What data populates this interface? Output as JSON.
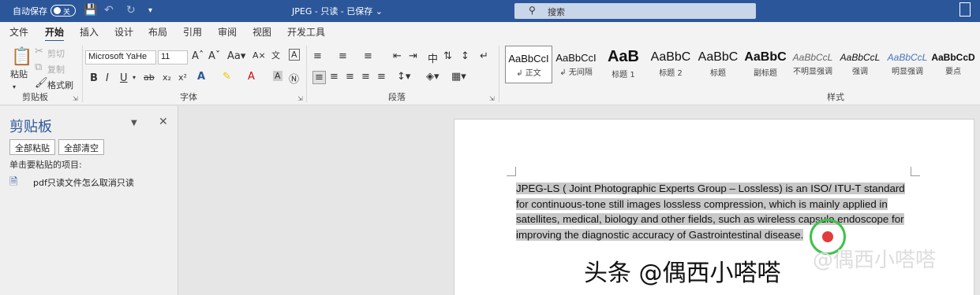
{
  "titlebar": {
    "autosave_label": "自动保存",
    "autosave_state": "关",
    "doc_title": "JPEG - 只读 - 已保存 ⌄",
    "search_label": "搜索"
  },
  "tabs": [
    "文件",
    "开始",
    "插入",
    "设计",
    "布局",
    "引用",
    "审阅",
    "视图",
    "开发工具"
  ],
  "ribbon": {
    "clipboard": {
      "paste": "粘贴",
      "cut": "剪切",
      "copy": "复制",
      "format_painter": "格式刷",
      "group_label": "剪贴板"
    },
    "font": {
      "font_name": "Microsoft YaHe",
      "font_size": "11",
      "group_label": "字体"
    },
    "paragraph": {
      "group_label": "段落"
    },
    "styles": {
      "group_label": "样式",
      "items": [
        {
          "sample": "AaBbCcI",
          "name": "↲ 正文"
        },
        {
          "sample": "AaBbCcI",
          "name": "↲ 无间隔"
        },
        {
          "sample": "AaB",
          "name": "标题 1"
        },
        {
          "sample": "AaBbC",
          "name": "标题 2"
        },
        {
          "sample": "AaBbC",
          "name": "标题"
        },
        {
          "sample": "AaBbC",
          "name": "副标题"
        },
        {
          "sample": "AaBbCcL",
          "name": "不明显强调"
        },
        {
          "sample": "AaBbCcL",
          "name": "强调"
        },
        {
          "sample": "AaBbCcL",
          "name": "明显强调"
        },
        {
          "sample": "AaBbCcD",
          "name": "要点"
        }
      ]
    }
  },
  "clipboard_pane": {
    "title": "剪贴板",
    "paste_all": "全部粘贴",
    "clear_all": "全部清空",
    "hint": "单击要粘贴的项目:",
    "items": [
      {
        "label": "pdf只读文件怎么取消只读"
      }
    ]
  },
  "document": {
    "paragraph": "JPEG-LS ( Joint Photographic Experts Group – Lossless) is an ISO/ ITU-T standard for continuous-tone still images lossless compression, which is mainly applied in satellites, medical, biology and other fields, such as wireless capsule endoscope for improving the diagnostic accuracy of Gastrointestinal disease."
  },
  "watermark": "头条 @偶西小嗒嗒",
  "watermark_ghost": "@偶西小嗒嗒",
  "colors": {
    "accent": "#2b579a",
    "cursor_ring": "#3ec24a",
    "cursor_dot": "#e23b3b",
    "selection": "#c8c8c8"
  }
}
